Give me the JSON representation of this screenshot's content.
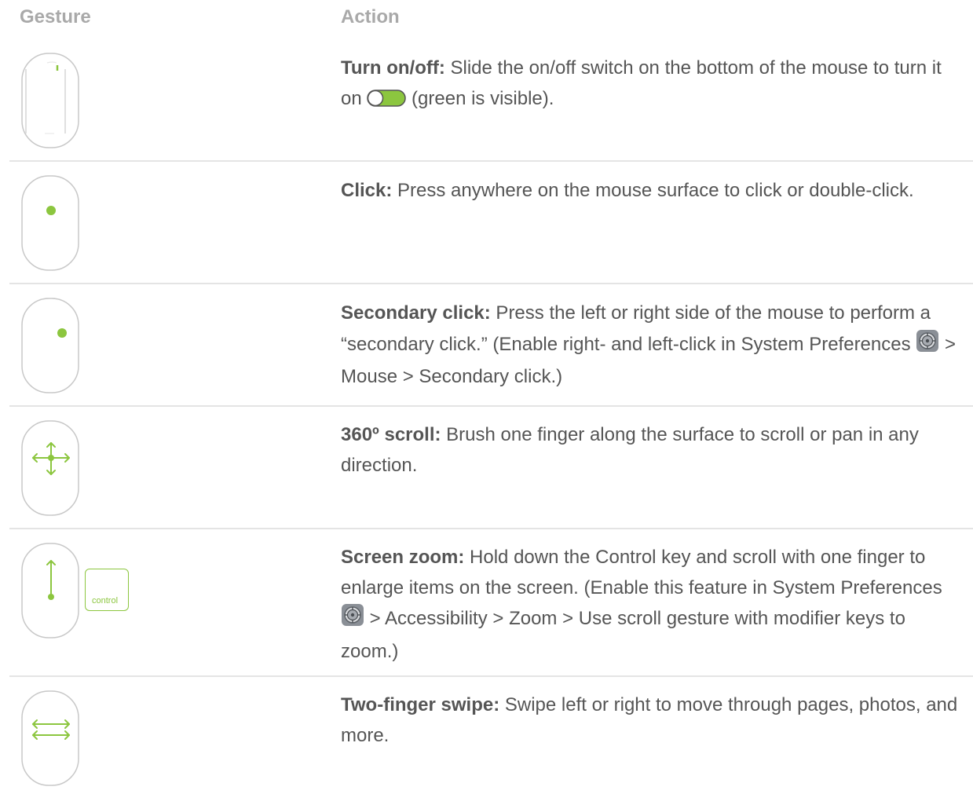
{
  "header": {
    "gesture": "Gesture",
    "action": "Action"
  },
  "colors": {
    "accent_green": "#8cc63f",
    "mouse_outline": "#c8c8c8",
    "divider": "#e4e4e4",
    "text": "#555555",
    "header_text": "#a9a9a9"
  },
  "rows": [
    {
      "icon": "mouse-top-side-icon",
      "term": "Turn on/off:",
      "before": " Slide the on/off switch on the bottom of the mouse to turn it on ",
      "after": " (green is visible).",
      "inline_icon": "green-toggle-switch-icon"
    },
    {
      "icon": "mouse-click-icon",
      "term": "Click:",
      "before": " Press anywhere on the mouse surface to click or double-click."
    },
    {
      "icon": "mouse-secondary-click-icon",
      "term": "Secondary click:",
      "before": " Press the left or right side of the mouse to perform a “secondary click.” (Enable right- and left-click in System Preferences ",
      "after": " > Mouse > Secondary click.)",
      "inline_icon": "system-preferences-icon"
    },
    {
      "icon": "mouse-scroll-icon",
      "term": "360º scroll:",
      "before": " Brush one finger along the surface to scroll or pan in any direction."
    },
    {
      "icon": "mouse-zoom-icon",
      "key_label": "control",
      "term": "Screen zoom:",
      "before": " Hold down the Control key and scroll with one finger to enlarge items on the screen. (Enable this feature in System Preferences ",
      "after": " > Accessibility > Zoom > Use scroll gesture with modifier keys to zoom.)",
      "inline_icon": "system-preferences-icon"
    },
    {
      "icon": "mouse-swipe-icon",
      "term": "Two-finger swipe:",
      "before": " Swipe left or right to move through pages, photos, and more."
    }
  ]
}
